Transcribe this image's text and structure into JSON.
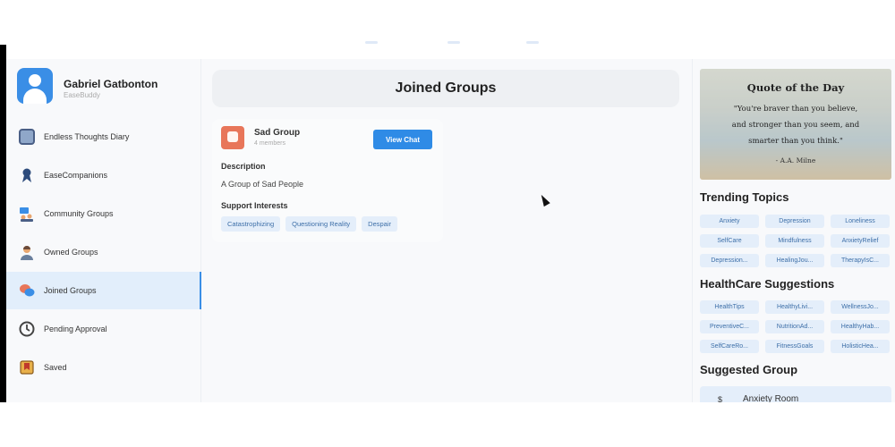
{
  "profile": {
    "name": "Gabriel Gatbonton",
    "subtitle": "EaseBuddy"
  },
  "sidebar": {
    "items": [
      {
        "label": "Endless Thoughts Diary",
        "icon": "diary-icon",
        "active": false
      },
      {
        "label": "EaseCompanions",
        "icon": "ribbon-icon",
        "active": false
      },
      {
        "label": "Community Groups",
        "icon": "community-icon",
        "active": false
      },
      {
        "label": "Owned Groups",
        "icon": "person-icon",
        "active": false
      },
      {
        "label": "Joined Groups",
        "icon": "chat-bubbles-icon",
        "active": true
      },
      {
        "label": "Pending Approval",
        "icon": "pending-icon",
        "active": false
      },
      {
        "label": "Saved",
        "icon": "bookmark-icon",
        "active": false
      }
    ]
  },
  "main": {
    "title": "Joined Groups",
    "group": {
      "name": "Sad Group",
      "members": "4 members",
      "button": "View Chat",
      "description_label": "Description",
      "description": "A Group of Sad People",
      "interests_label": "Support Interests",
      "interests": [
        "Catastrophizing",
        "Questioning Reality",
        "Despair"
      ]
    }
  },
  "right": {
    "quote": {
      "title": "Quote of the Day",
      "lines": [
        "\"You're braver than you believe,",
        "and stronger than you seem, and",
        "smarter than you think.\""
      ],
      "author": "- A.A. Milne"
    },
    "trending_title": "Trending Topics",
    "trending": [
      "Anxiety",
      "Depression",
      "Loneliness",
      "SelfCare",
      "Mindfulness",
      "AnxietyRelief",
      "Depression...",
      "HealingJou...",
      "TherapyIsC..."
    ],
    "health_title": "HealthCare Suggestions",
    "health": [
      "HealthTips",
      "HealthyLivi...",
      "WellnessJo...",
      "PreventiveC...",
      "NutritionAd...",
      "HealthyHab...",
      "SelfCareRo...",
      "FitnessGoals",
      "HolisticHea..."
    ],
    "suggested_title": "Suggested Group",
    "suggested": {
      "icon_text": "$",
      "name": "Anxiety Room"
    }
  },
  "colors": {
    "accent": "#2f8be6",
    "chip_bg": "#e4eefa",
    "chip_text": "#3d6fa8",
    "active_bg": "#e2eefb"
  }
}
